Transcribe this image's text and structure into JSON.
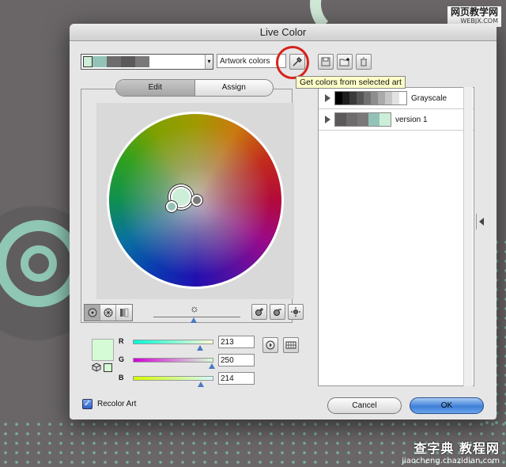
{
  "watermark_top": {
    "title": "网页教学网",
    "url": "WEBJX.COM"
  },
  "watermark_bottom": {
    "title": "查字典 教程网",
    "url": "jiaocheng.chazidian.com"
  },
  "dialog": {
    "title": "Live Color",
    "current_colors": [
      "#cdeed8",
      "#93c3b6",
      "#6f6c6d",
      "#5c595a",
      "#7b7879"
    ],
    "name_field": "Artwork colors",
    "tooltip": "Get colors from selected art",
    "tabs": [
      {
        "label": "Edit",
        "active": true
      },
      {
        "label": "Assign",
        "active": false
      }
    ],
    "sliders": [
      {
        "label": "R",
        "value": "213",
        "fraction": 0.835,
        "gradient": [
          "#00fad6",
          "#fffad6"
        ]
      },
      {
        "label": "G",
        "value": "250",
        "fraction": 0.98,
        "gradient": [
          "#d500d6",
          "#d5ffd6"
        ]
      },
      {
        "label": "B",
        "value": "214",
        "fraction": 0.84,
        "gradient": [
          "#d5fa00",
          "#d5faff"
        ]
      }
    ],
    "preview_color": "#d5fad6",
    "color_groups": [
      {
        "name": "Grayscale",
        "colors": [
          "#000000",
          "#1e1e1e",
          "#3a3a3a",
          "#555555",
          "#717171",
          "#8d8d8d",
          "#aaaaaa",
          "#c6c6c6",
          "#e2e2e2",
          "#ffffff"
        ]
      },
      {
        "name": "version 1",
        "colors": [
          "#5c595a",
          "#6f6c6d",
          "#7b7879",
          "#93c3b6",
          "#cdeed8"
        ]
      }
    ],
    "recolor_art": {
      "label": "Recolor Art",
      "checked": true
    },
    "cancel_label": "Cancel",
    "ok_label": "OK"
  }
}
